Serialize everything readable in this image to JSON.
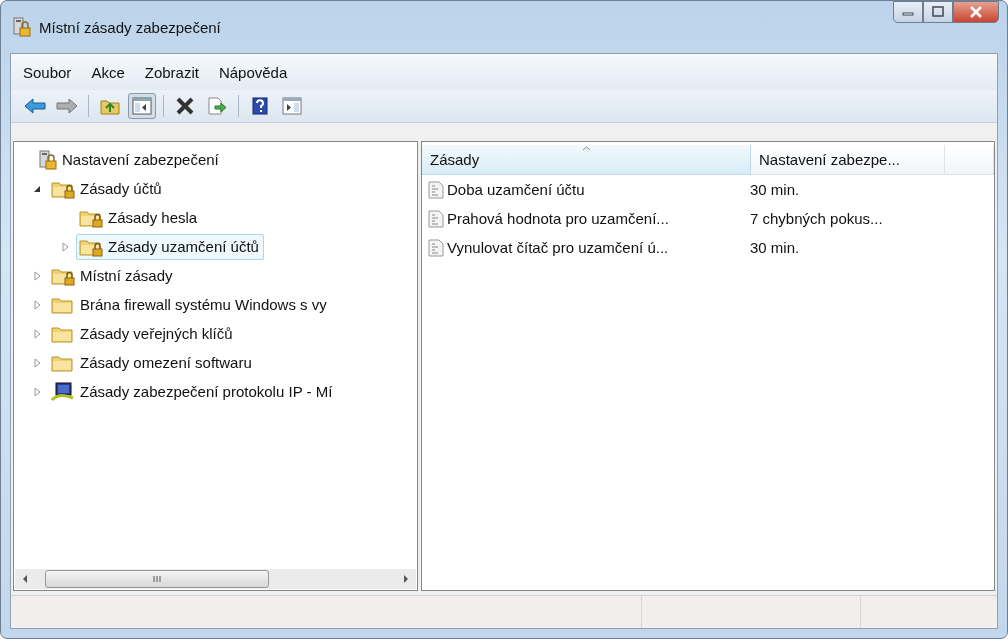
{
  "window": {
    "title": "Místní zásady zabezpečení"
  },
  "menu": [
    "Soubor",
    "Akce",
    "Zobrazit",
    "Nápověda"
  ],
  "toolbar": {
    "forward_disabled": true,
    "tree_toggle_pressed": true
  },
  "tree": {
    "label": "Nastavení zabezpečení",
    "kind": "security",
    "selected": false,
    "children": [
      {
        "label": "Zásady účtů",
        "kind": "lock-folder",
        "expanded": true,
        "selected": false,
        "children": [
          {
            "label": "Zásady hesla",
            "kind": "lock-folder",
            "selected": false
          },
          {
            "label": "Zásady uzamčení účtů",
            "kind": "lock-folder",
            "expanded": false,
            "selected": true
          }
        ]
      },
      {
        "label": "Místní zásady",
        "kind": "lock-folder",
        "expanded": false,
        "selected": false
      },
      {
        "label": "Brána firewall systému Windows s vy",
        "kind": "folder",
        "expanded": false,
        "selected": false
      },
      {
        "label": "Zásady veřejných klíčů",
        "kind": "folder",
        "expanded": false,
        "selected": false
      },
      {
        "label": "Zásady omezení softwaru",
        "kind": "folder",
        "expanded": false,
        "selected": false
      },
      {
        "label": "Zásady zabezpečení protokolu IP - Mí",
        "kind": "network",
        "expanded": false,
        "selected": false
      }
    ]
  },
  "list": {
    "columns": [
      {
        "label": "Zásady",
        "sorted": true
      },
      {
        "label": "Nastavení zabezpe...",
        "sorted": false
      }
    ],
    "rows": [
      {
        "policy": "Doba uzamčení účtu",
        "setting": "30 min."
      },
      {
        "policy": "Prahová hodnota pro uzamčení...",
        "setting": "7 chybných pokus..."
      },
      {
        "policy": "Vynulovat čítač pro uzamčení ú...",
        "setting": "30 min."
      }
    ]
  }
}
